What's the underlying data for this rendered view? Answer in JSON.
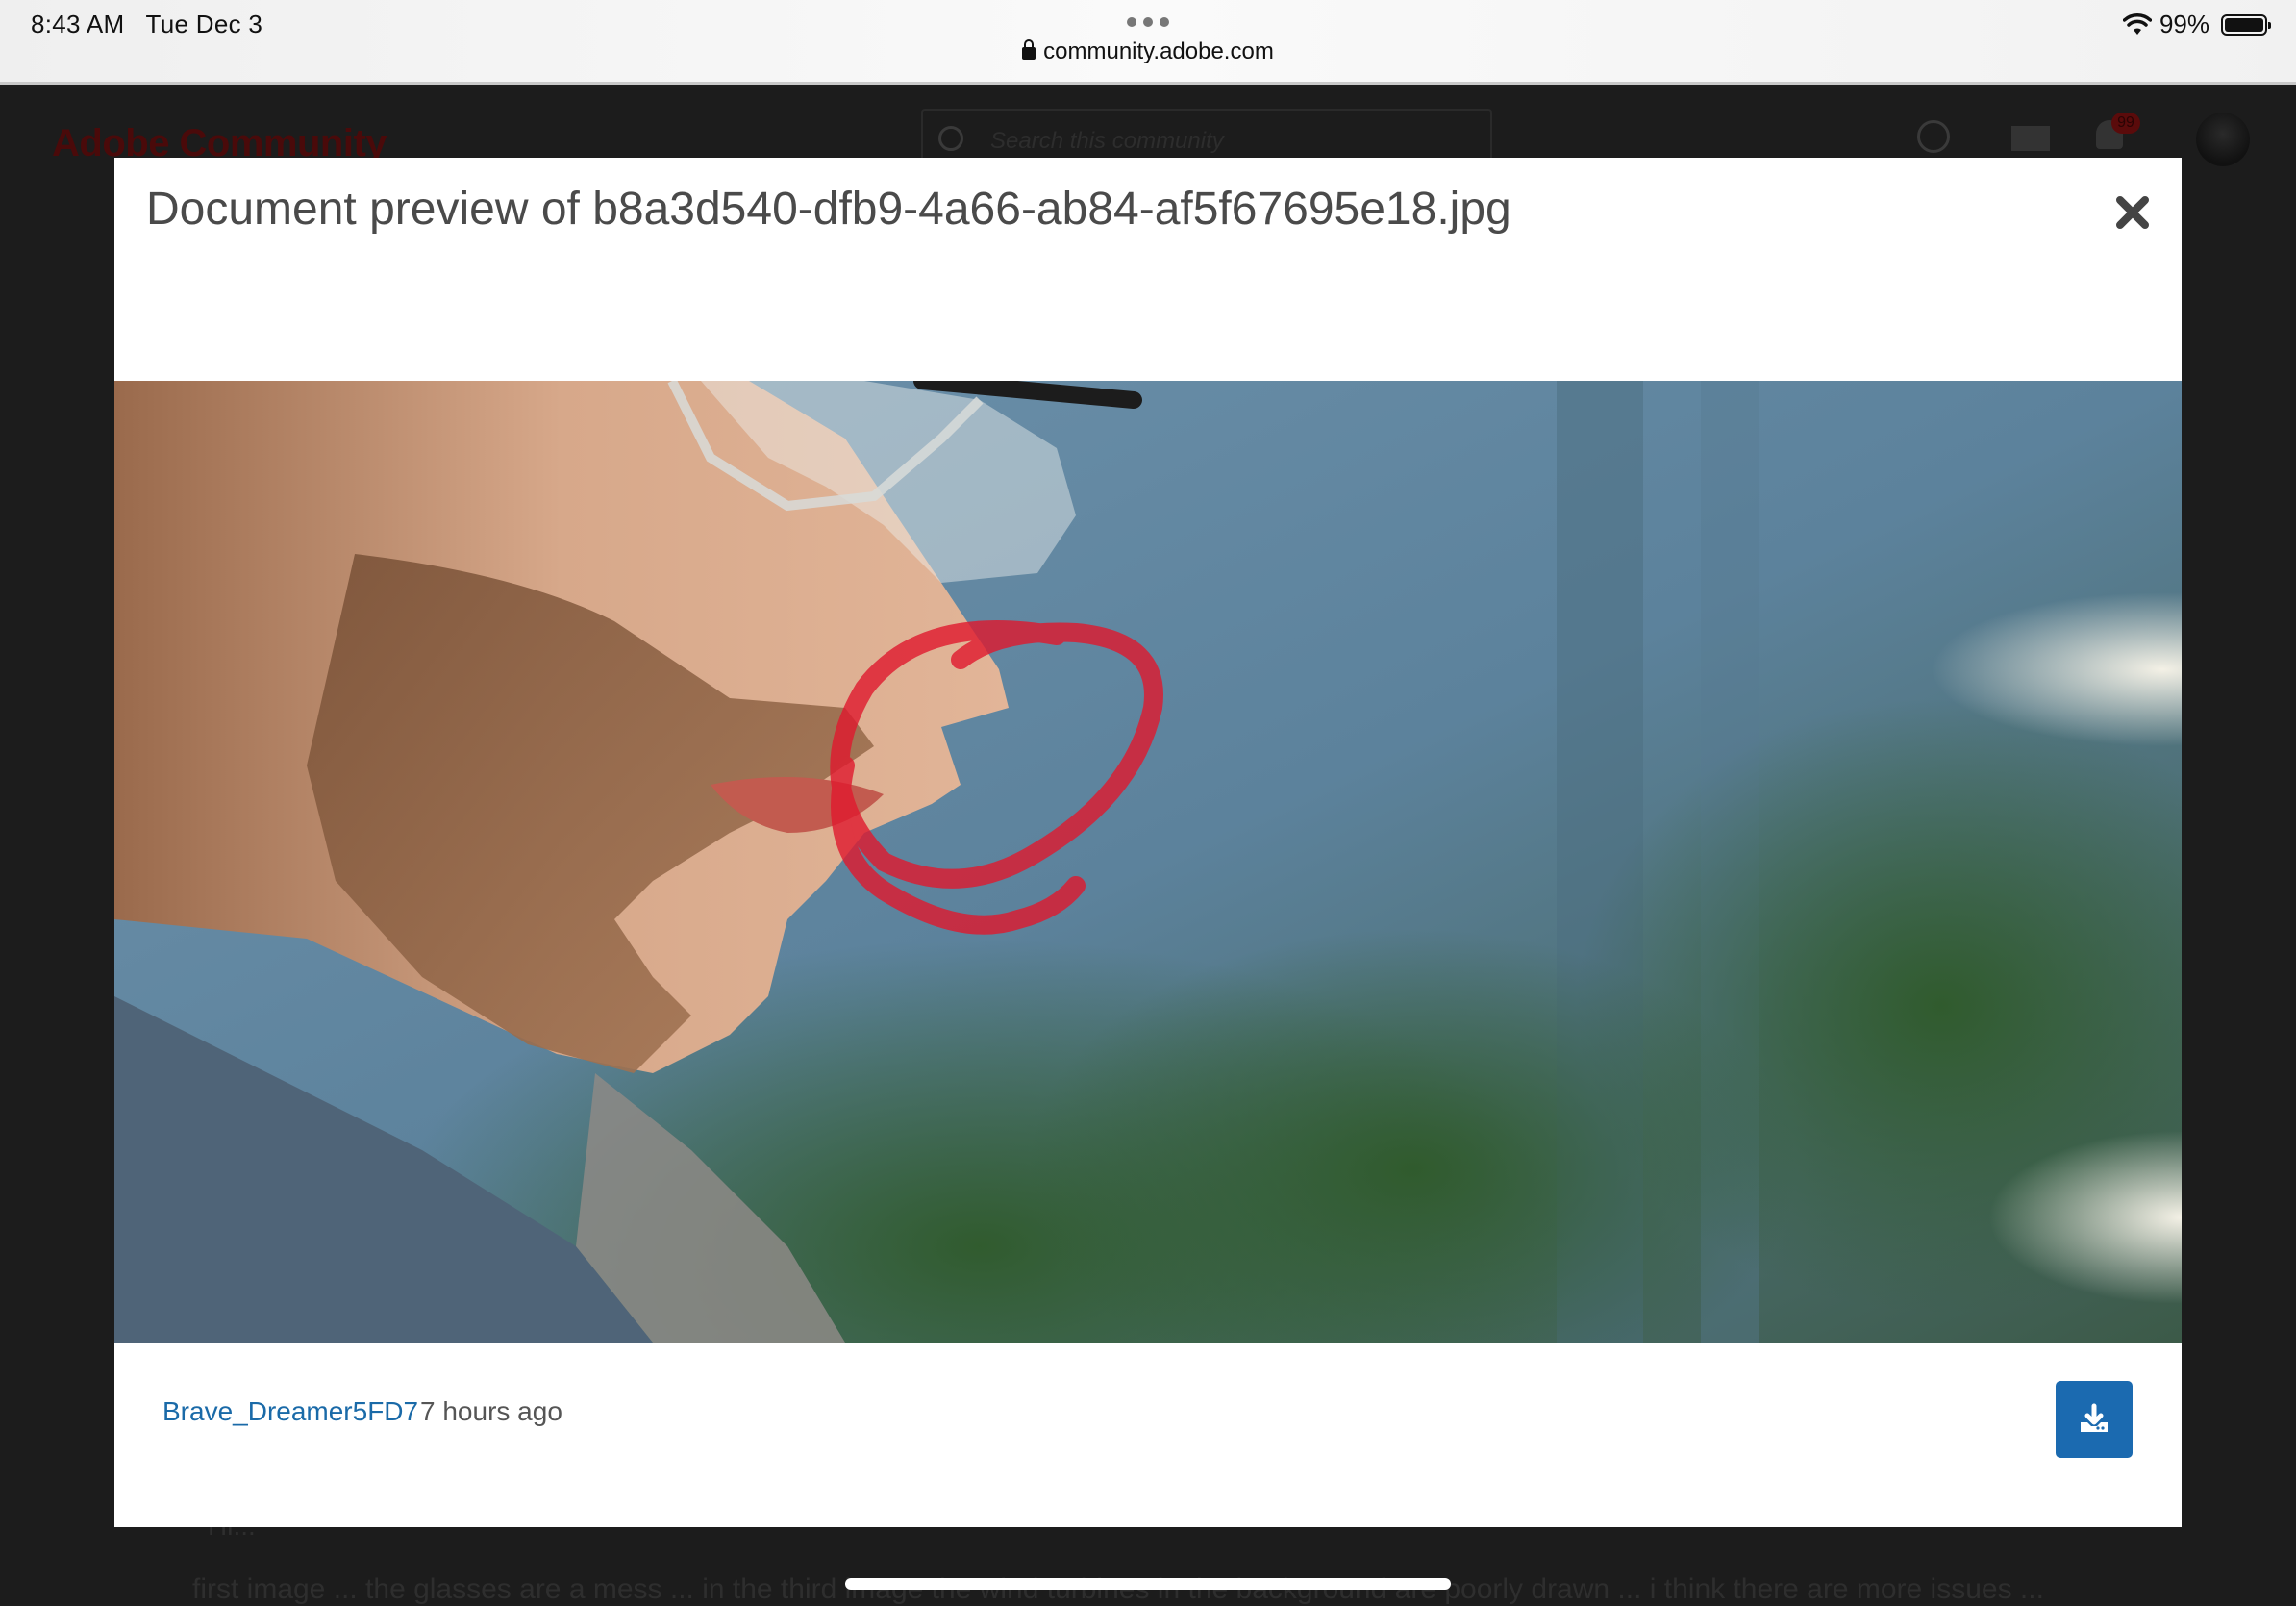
{
  "status_bar": {
    "time": "8:43 AM",
    "date": "Tue Dec 3",
    "url": "community.adobe.com",
    "battery": "99%",
    "battery_level": 0.99,
    "icons": [
      "lock-icon",
      "wifi-icon",
      "battery-icon"
    ]
  },
  "background_page": {
    "logo": "Adobe Community",
    "search_placeholder": "Search this community",
    "notification_count": "99",
    "post_fragment": "first image ... the glasses are a mess ... in the third image the wind turbines in the background are poorly drawn ... i think there are more issues ...",
    "post_fragment_2": "Hi..."
  },
  "modal": {
    "title": "Document preview of b8a3d540-dfb9-4a66-ab84-af5f67695e18.jpg",
    "close_icon": "close-icon",
    "author": "Brave_Dreamer5FD7",
    "time_ago": "7 hours ago",
    "download_icon": "download-icon"
  },
  "colors": {
    "accent": "#1b6ab0",
    "link": "#1a6aa8",
    "annotation": "#e0192e"
  }
}
